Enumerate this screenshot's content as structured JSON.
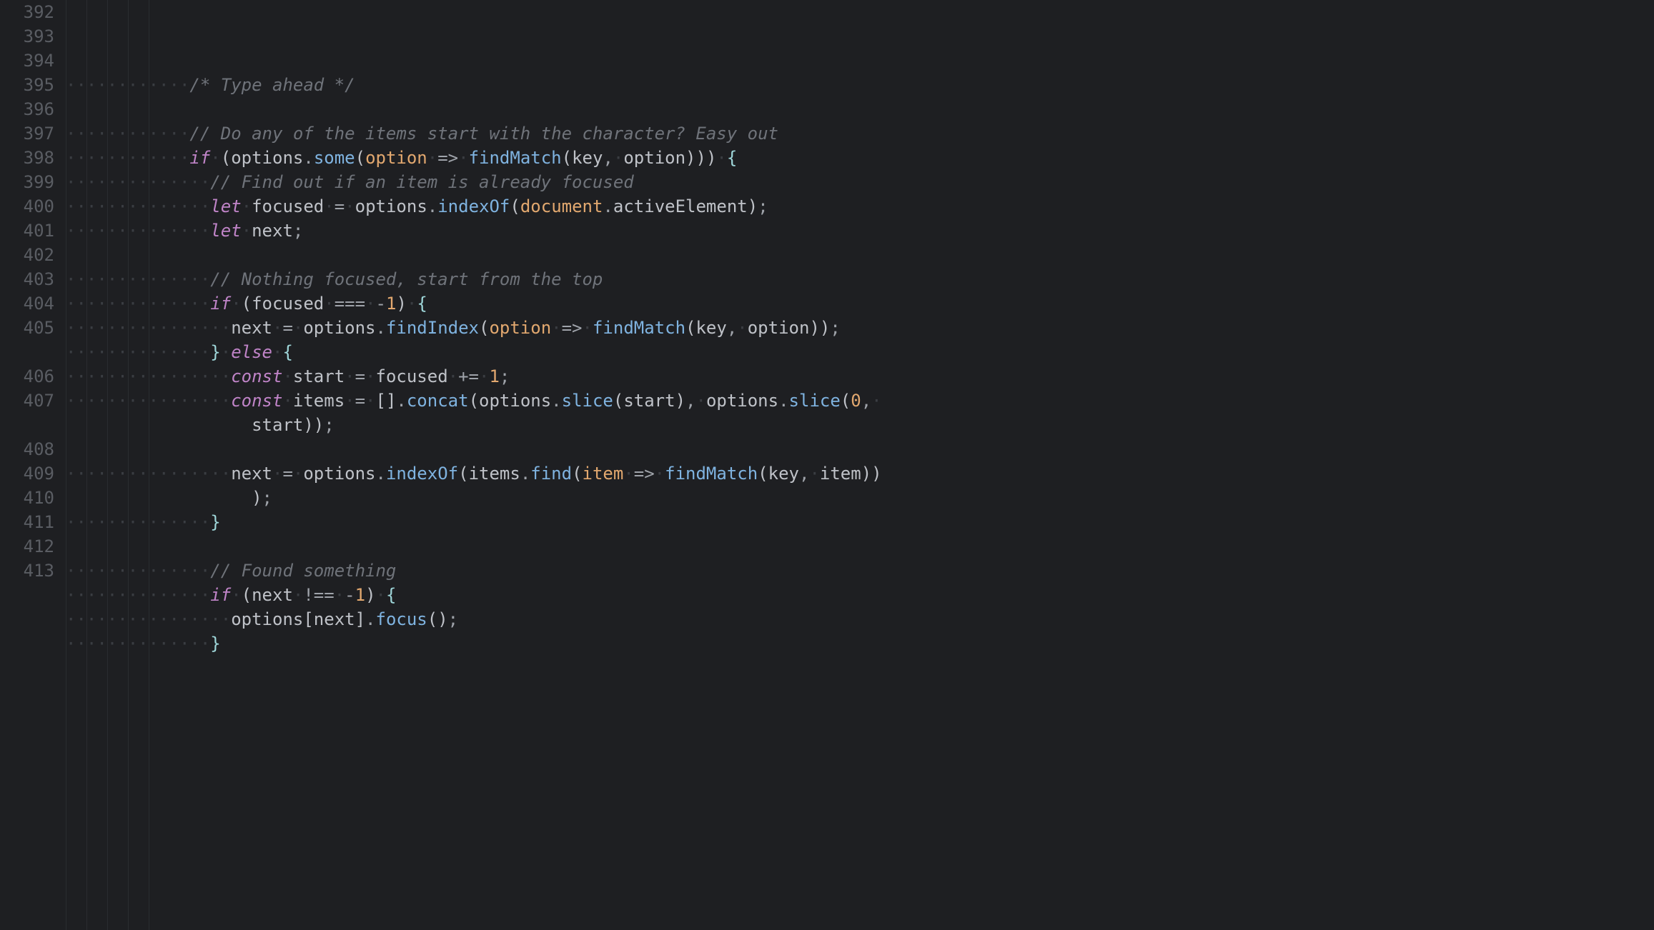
{
  "editor": {
    "startLine": 392,
    "lines": [
      {
        "num": 392,
        "indent": 12,
        "tokens": [
          {
            "t": "/* Type ahead */",
            "c": "comment"
          }
        ]
      },
      {
        "num": 393,
        "indent": 0,
        "tokens": []
      },
      {
        "num": 394,
        "indent": 12,
        "tokens": [
          {
            "t": "// Do any of the items start with the character? Easy out",
            "c": "comment"
          }
        ]
      },
      {
        "num": 395,
        "indent": 12,
        "tokens": [
          {
            "t": "if",
            "c": "kw"
          },
          {
            "t": " ",
            "c": "ws-vis"
          },
          {
            "t": "(",
            "c": "paren"
          },
          {
            "t": "options",
            "c": "prop"
          },
          {
            "t": ".",
            "c": "op"
          },
          {
            "t": "some",
            "c": "fn"
          },
          {
            "t": "(",
            "c": "paren"
          },
          {
            "t": "option",
            "c": "param"
          },
          {
            "t": " ",
            "c": "ws-vis"
          },
          {
            "t": "=>",
            "c": "arrow"
          },
          {
            "t": " ",
            "c": "ws-vis"
          },
          {
            "t": "findMatch",
            "c": "fn"
          },
          {
            "t": "(",
            "c": "paren"
          },
          {
            "t": "key",
            "c": "prop"
          },
          {
            "t": ",",
            "c": "op"
          },
          {
            "t": " ",
            "c": "ws-vis"
          },
          {
            "t": "option",
            "c": "prop"
          },
          {
            "t": ")",
            "c": "paren"
          },
          {
            "t": ")",
            "c": "paren"
          },
          {
            "t": ")",
            "c": "paren"
          },
          {
            "t": " ",
            "c": "ws-vis"
          },
          {
            "t": "{",
            "c": "brace"
          }
        ]
      },
      {
        "num": 396,
        "indent": 14,
        "tokens": [
          {
            "t": "// Find out if an item is already focused",
            "c": "comment"
          }
        ]
      },
      {
        "num": 397,
        "indent": 14,
        "tokens": [
          {
            "t": "let",
            "c": "kw"
          },
          {
            "t": " ",
            "c": "ws-vis"
          },
          {
            "t": "focused",
            "c": "prop"
          },
          {
            "t": " ",
            "c": "ws-vis"
          },
          {
            "t": "=",
            "c": "op"
          },
          {
            "t": " ",
            "c": "ws-vis"
          },
          {
            "t": "options",
            "c": "prop"
          },
          {
            "t": ".",
            "c": "op"
          },
          {
            "t": "indexOf",
            "c": "fn"
          },
          {
            "t": "(",
            "c": "paren"
          },
          {
            "t": "document",
            "c": "param"
          },
          {
            "t": ".",
            "c": "op"
          },
          {
            "t": "activeElement",
            "c": "prop"
          },
          {
            "t": ")",
            "c": "paren"
          },
          {
            "t": ";",
            "c": "semi"
          }
        ]
      },
      {
        "num": 398,
        "indent": 14,
        "tokens": [
          {
            "t": "let",
            "c": "kw"
          },
          {
            "t": " ",
            "c": "ws-vis"
          },
          {
            "t": "next",
            "c": "prop"
          },
          {
            "t": ";",
            "c": "semi"
          }
        ]
      },
      {
        "num": 399,
        "indent": 0,
        "tokens": []
      },
      {
        "num": 400,
        "indent": 14,
        "tokens": [
          {
            "t": "// Nothing focused, start from the top",
            "c": "comment"
          }
        ]
      },
      {
        "num": 401,
        "indent": 14,
        "tokens": [
          {
            "t": "if",
            "c": "kw"
          },
          {
            "t": " ",
            "c": "ws-vis"
          },
          {
            "t": "(",
            "c": "paren"
          },
          {
            "t": "focused",
            "c": "prop"
          },
          {
            "t": " ",
            "c": "ws-vis"
          },
          {
            "t": "===",
            "c": "op"
          },
          {
            "t": " ",
            "c": "ws-vis"
          },
          {
            "t": "-",
            "c": "op"
          },
          {
            "t": "1",
            "c": "num"
          },
          {
            "t": ")",
            "c": "paren"
          },
          {
            "t": " ",
            "c": "ws-vis"
          },
          {
            "t": "{",
            "c": "brace"
          }
        ]
      },
      {
        "num": 402,
        "indent": 16,
        "tokens": [
          {
            "t": "next",
            "c": "prop"
          },
          {
            "t": " ",
            "c": "ws-vis"
          },
          {
            "t": "=",
            "c": "op"
          },
          {
            "t": " ",
            "c": "ws-vis"
          },
          {
            "t": "options",
            "c": "prop"
          },
          {
            "t": ".",
            "c": "op"
          },
          {
            "t": "findIndex",
            "c": "fn"
          },
          {
            "t": "(",
            "c": "paren"
          },
          {
            "t": "option",
            "c": "param"
          },
          {
            "t": " ",
            "c": "ws-vis"
          },
          {
            "t": "=>",
            "c": "arrow"
          },
          {
            "t": " ",
            "c": "ws-vis"
          },
          {
            "t": "findMatch",
            "c": "fn"
          },
          {
            "t": "(",
            "c": "paren"
          },
          {
            "t": "key",
            "c": "prop"
          },
          {
            "t": ",",
            "c": "op"
          },
          {
            "t": " ",
            "c": "ws-vis"
          },
          {
            "t": "option",
            "c": "prop"
          },
          {
            "t": ")",
            "c": "paren"
          },
          {
            "t": ")",
            "c": "paren"
          },
          {
            "t": ";",
            "c": "semi"
          }
        ]
      },
      {
        "num": 403,
        "indent": 14,
        "tokens": [
          {
            "t": "}",
            "c": "brace"
          },
          {
            "t": " ",
            "c": "ws-vis"
          },
          {
            "t": "else",
            "c": "kw"
          },
          {
            "t": " ",
            "c": "ws-vis"
          },
          {
            "t": "{",
            "c": "brace"
          }
        ]
      },
      {
        "num": 404,
        "indent": 16,
        "tokens": [
          {
            "t": "const",
            "c": "kw"
          },
          {
            "t": " ",
            "c": "ws-vis"
          },
          {
            "t": "start",
            "c": "prop"
          },
          {
            "t": " ",
            "c": "ws-vis"
          },
          {
            "t": "=",
            "c": "op"
          },
          {
            "t": " ",
            "c": "ws-vis"
          },
          {
            "t": "focused",
            "c": "prop"
          },
          {
            "t": " ",
            "c": "ws-vis"
          },
          {
            "t": "+=",
            "c": "op"
          },
          {
            "t": " ",
            "c": "ws-vis"
          },
          {
            "t": "1",
            "c": "num"
          },
          {
            "t": ";",
            "c": "semi"
          }
        ]
      },
      {
        "num": 405,
        "indent": 16,
        "tokens": [
          {
            "t": "const",
            "c": "kw"
          },
          {
            "t": " ",
            "c": "ws-vis"
          },
          {
            "t": "items",
            "c": "prop"
          },
          {
            "t": " ",
            "c": "ws-vis"
          },
          {
            "t": "=",
            "c": "op"
          },
          {
            "t": " ",
            "c": "ws-vis"
          },
          {
            "t": "[]",
            "c": "paren"
          },
          {
            "t": ".",
            "c": "op"
          },
          {
            "t": "concat",
            "c": "fn"
          },
          {
            "t": "(",
            "c": "paren"
          },
          {
            "t": "options",
            "c": "prop"
          },
          {
            "t": ".",
            "c": "op"
          },
          {
            "t": "slice",
            "c": "fn"
          },
          {
            "t": "(",
            "c": "paren"
          },
          {
            "t": "start",
            "c": "prop"
          },
          {
            "t": ")",
            "c": "paren"
          },
          {
            "t": ",",
            "c": "op"
          },
          {
            "t": " ",
            "c": "ws-vis"
          },
          {
            "t": "options",
            "c": "prop"
          },
          {
            "t": ".",
            "c": "op"
          },
          {
            "t": "slice",
            "c": "fn"
          },
          {
            "t": "(",
            "c": "paren"
          },
          {
            "t": "0",
            "c": "num"
          },
          {
            "t": ",",
            "c": "op"
          },
          {
            "t": " ",
            "c": "ws-vis"
          }
        ],
        "wrap": {
          "indent": 18,
          "tokens": [
            {
              "t": "start",
              "c": "prop"
            },
            {
              "t": ")",
              "c": "paren"
            },
            {
              "t": ")",
              "c": "paren"
            },
            {
              "t": ";",
              "c": "semi"
            }
          ]
        }
      },
      {
        "num": 406,
        "indent": 0,
        "tokens": []
      },
      {
        "num": 407,
        "indent": 16,
        "tokens": [
          {
            "t": "next",
            "c": "prop"
          },
          {
            "t": " ",
            "c": "ws-vis"
          },
          {
            "t": "=",
            "c": "op"
          },
          {
            "t": " ",
            "c": "ws-vis"
          },
          {
            "t": "options",
            "c": "prop"
          },
          {
            "t": ".",
            "c": "op"
          },
          {
            "t": "indexOf",
            "c": "fn"
          },
          {
            "t": "(",
            "c": "paren"
          },
          {
            "t": "items",
            "c": "prop"
          },
          {
            "t": ".",
            "c": "op"
          },
          {
            "t": "find",
            "c": "fn"
          },
          {
            "t": "(",
            "c": "paren"
          },
          {
            "t": "item",
            "c": "param"
          },
          {
            "t": " ",
            "c": "ws-vis"
          },
          {
            "t": "=>",
            "c": "arrow"
          },
          {
            "t": " ",
            "c": "ws-vis"
          },
          {
            "t": "findMatch",
            "c": "fn"
          },
          {
            "t": "(",
            "c": "paren"
          },
          {
            "t": "key",
            "c": "prop"
          },
          {
            "t": ",",
            "c": "op"
          },
          {
            "t": " ",
            "c": "ws-vis"
          },
          {
            "t": "item",
            "c": "prop"
          },
          {
            "t": ")",
            "c": "paren"
          },
          {
            "t": ")",
            "c": "paren"
          }
        ],
        "wrap": {
          "indent": 18,
          "tokens": [
            {
              "t": ")",
              "c": "paren"
            },
            {
              "t": ";",
              "c": "semi"
            }
          ]
        }
      },
      {
        "num": 408,
        "indent": 14,
        "tokens": [
          {
            "t": "}",
            "c": "brace"
          }
        ]
      },
      {
        "num": 409,
        "indent": 0,
        "tokens": []
      },
      {
        "num": 410,
        "indent": 14,
        "tokens": [
          {
            "t": "// Found something",
            "c": "comment"
          }
        ]
      },
      {
        "num": 411,
        "indent": 14,
        "tokens": [
          {
            "t": "if",
            "c": "kw"
          },
          {
            "t": " ",
            "c": "ws-vis"
          },
          {
            "t": "(",
            "c": "paren"
          },
          {
            "t": "next",
            "c": "prop"
          },
          {
            "t": " ",
            "c": "ws-vis"
          },
          {
            "t": "!==",
            "c": "op"
          },
          {
            "t": " ",
            "c": "ws-vis"
          },
          {
            "t": "-",
            "c": "op"
          },
          {
            "t": "1",
            "c": "num"
          },
          {
            "t": ")",
            "c": "paren"
          },
          {
            "t": " ",
            "c": "ws-vis"
          },
          {
            "t": "{",
            "c": "brace"
          }
        ]
      },
      {
        "num": 412,
        "indent": 16,
        "tokens": [
          {
            "t": "options",
            "c": "prop"
          },
          {
            "t": "[",
            "c": "paren"
          },
          {
            "t": "next",
            "c": "prop"
          },
          {
            "t": "]",
            "c": "paren"
          },
          {
            "t": ".",
            "c": "op"
          },
          {
            "t": "focus",
            "c": "fn"
          },
          {
            "t": "(",
            "c": "paren"
          },
          {
            "t": ")",
            "c": "paren"
          },
          {
            "t": ";",
            "c": "semi"
          }
        ]
      },
      {
        "num": 413,
        "indent": 14,
        "tokens": [
          {
            "t": "}",
            "c": "brace"
          }
        ]
      }
    ],
    "indentGuideColumns": [
      0,
      2,
      4,
      6,
      8
    ]
  }
}
